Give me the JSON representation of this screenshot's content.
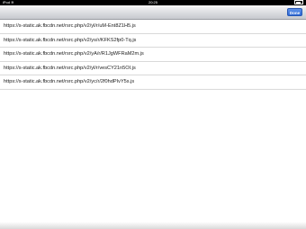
{
  "status_bar": {
    "carrier": "iPod",
    "wifi_icon": "wifi-icon",
    "time": "20:25",
    "battery_icon": "battery-icon"
  },
  "toolbar": {
    "done_label": "Done"
  },
  "script_list": [
    "https://s-static.ak.fbcdn.net/rsrc.php/v2/yl/r/uM-Ent8Z1H5.js",
    "https://s-static.ak.fbcdn.net/rsrc.php/v2/ys/r/KFKS2fp0-Tq.js",
    "https://s-static.ak.fbcdn.net/rsrc.php/v2/yA/r/R1JgWFRaM2m.js",
    "https://s-static.ak.fbcdn.net/rsrc.php/v2/yl/r/vesCY21n5OI.js",
    "https://s-static.ak.fbcdn.net/rsrc.php/v2/yc/r/2f0hdPIvY5s.js"
  ],
  "colors": {
    "done_button": "#2e69d6",
    "status_bar": "#000000"
  }
}
